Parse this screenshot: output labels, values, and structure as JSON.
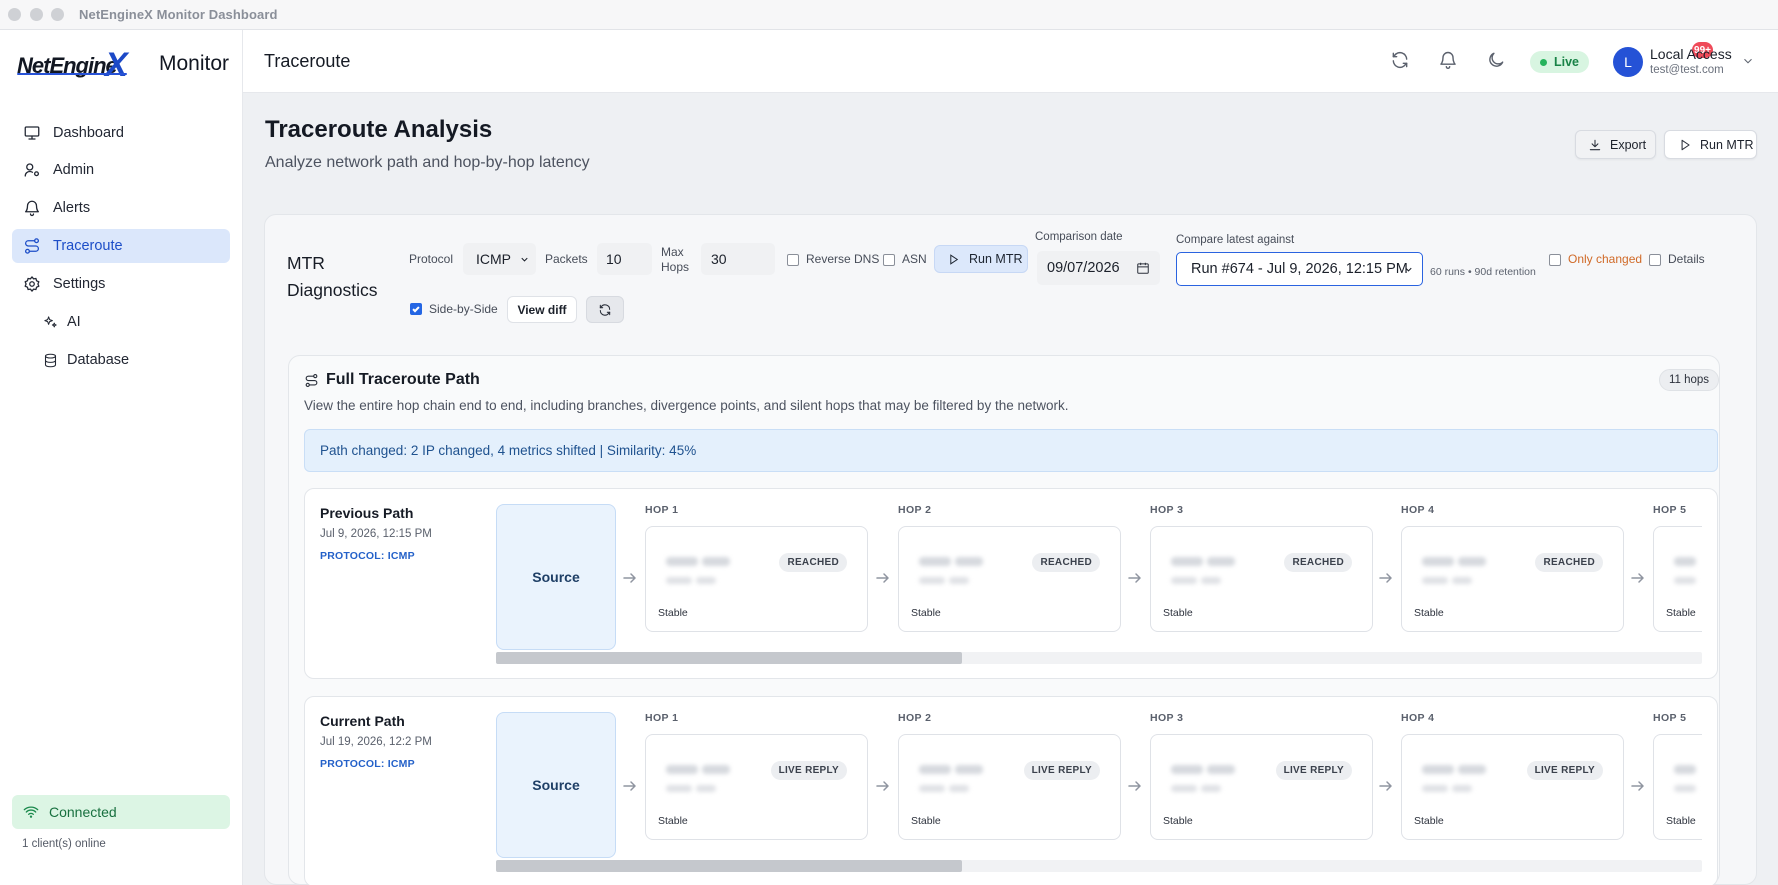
{
  "window": {
    "title": "NetEngineX Monitor Dashboard"
  },
  "brand": {
    "logo_text": "NetEngine",
    "logo_x": "X",
    "suffix": "Monitor"
  },
  "sidebar": {
    "items": [
      {
        "label": "Dashboard",
        "icon": "monitor-icon"
      },
      {
        "label": "Admin",
        "icon": "user-cog-icon"
      },
      {
        "label": "Alerts",
        "icon": "bell-icon"
      },
      {
        "label": "Traceroute",
        "icon": "route-icon",
        "active": true
      },
      {
        "label": "Settings",
        "icon": "gear-icon"
      }
    ],
    "sub_items": [
      {
        "label": "AI",
        "icon": "sparkles-icon"
      },
      {
        "label": "Database",
        "icon": "database-icon"
      }
    ],
    "connection": {
      "label": "Connected",
      "clients": "1 client(s) online"
    }
  },
  "topbar": {
    "page": "Traceroute",
    "notification_count": "99+",
    "live_label": "Live",
    "user": {
      "initial": "L",
      "name": "Local Access",
      "email": "test@test.com"
    }
  },
  "header": {
    "title": "Traceroute Analysis",
    "subtitle": "Analyze network path and hop-by-hop latency",
    "export_label": "Export",
    "run_mtr_label": "Run MTR"
  },
  "mtr": {
    "title": "MTR Diagnostics",
    "protocol_label": "Protocol",
    "protocol_value": "ICMP",
    "packets_label": "Packets",
    "packets_value": "10",
    "max_hops_label": "Max Hops",
    "max_hops_value": "30",
    "reverse_dns_label": "Reverse DNS",
    "asn_label": "ASN",
    "run_label": "Run MTR",
    "comparison_date_label": "Comparison date",
    "comparison_date_value": "09/07/2026",
    "compare_label": "Compare latest against",
    "compare_value": "Run #674 - Jul 9, 2026, 12:15 PM",
    "retention": "60 runs • 90d retention",
    "only_changed_label": "Only changed",
    "details_label": "Details",
    "side_by_side_label": "Side-by-Side",
    "side_by_side_checked": true,
    "view_diff_label": "View diff"
  },
  "full_path": {
    "title": "Full Traceroute Path",
    "description": "View the entire hop chain end to end, including branches, divergence points, and silent hops that may be filtered by the network.",
    "hops_badge": "11 hops",
    "change_summary": "Path changed: 2 IP changed, 4 metrics shifted | Similarity: 45%"
  },
  "paths": [
    {
      "title": "Previous Path",
      "date": "Jul 9, 2026, 12:15 PM",
      "protocol": "PROTOCOL: ICMP",
      "source": "Source",
      "hops": [
        {
          "label": "HOP 1",
          "status": "REACHED",
          "stability": "Stable"
        },
        {
          "label": "HOP 2",
          "status": "REACHED",
          "stability": "Stable"
        },
        {
          "label": "HOP 3",
          "status": "REACHED",
          "stability": "Stable"
        },
        {
          "label": "HOP 4",
          "status": "REACHED",
          "stability": "Stable"
        },
        {
          "label": "HOP 5",
          "status": "",
          "stability": "Stable"
        }
      ]
    },
    {
      "title": "Current Path",
      "date": "Jul 19, 2026, 12:2 PM",
      "protocol": "PROTOCOL: ICMP",
      "source": "Source",
      "hops": [
        {
          "label": "HOP 1",
          "status": "LIVE REPLY",
          "stability": "Stable"
        },
        {
          "label": "HOP 2",
          "status": "LIVE REPLY",
          "stability": "Stable"
        },
        {
          "label": "HOP 3",
          "status": "LIVE REPLY",
          "stability": "Stable"
        },
        {
          "label": "HOP 4",
          "status": "LIVE REPLY",
          "stability": "Stable"
        },
        {
          "label": "HOP 5",
          "status": "",
          "stability": "Stable"
        }
      ]
    }
  ],
  "colors": {
    "accent": "#2552d6",
    "live": "#25b35c",
    "badge": "#ef4a59",
    "only_changed": "#d06a28"
  }
}
